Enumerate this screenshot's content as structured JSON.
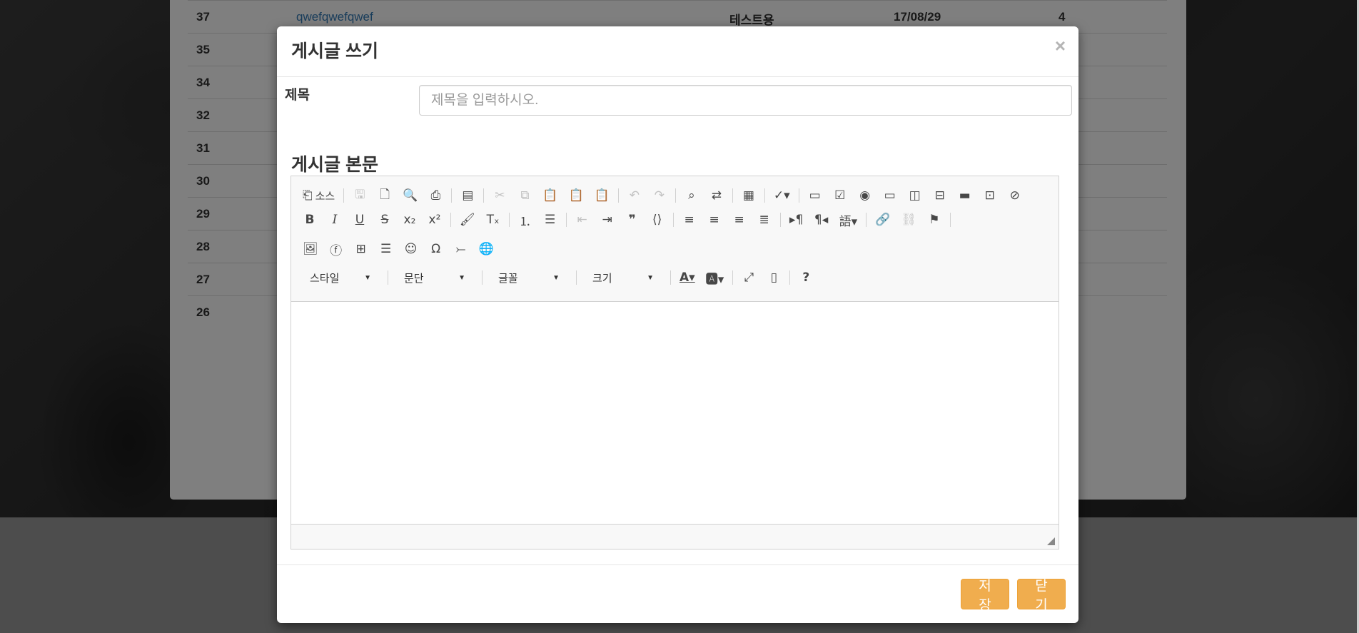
{
  "background_table": {
    "rows": [
      {
        "num": "37",
        "title": "qwefqwefqwef",
        "author": "테스트용",
        "date": "17/08/29",
        "views": "4"
      },
      {
        "num": "35"
      },
      {
        "num": "34"
      },
      {
        "num": "32"
      },
      {
        "num": "31"
      },
      {
        "num": "30"
      },
      {
        "num": "29"
      },
      {
        "num": "28"
      },
      {
        "num": "27"
      },
      {
        "num": "26"
      }
    ]
  },
  "modal": {
    "title": "게시글 쓰기",
    "close_symbol": "×",
    "subject_label": "제목",
    "subject_placeholder": "제목을 입력하시오.",
    "subject_value": "",
    "body_heading": "게시글 본문",
    "editor": {
      "source_label": "소스",
      "style_combo": "스타일",
      "format_combo": "문단",
      "font_combo": "글꼴",
      "size_combo": "크기"
    },
    "save_button": "저장",
    "close_button": "닫기"
  },
  "colors": {
    "accent_button": "#f0ad4e",
    "link": "#337ab7"
  }
}
